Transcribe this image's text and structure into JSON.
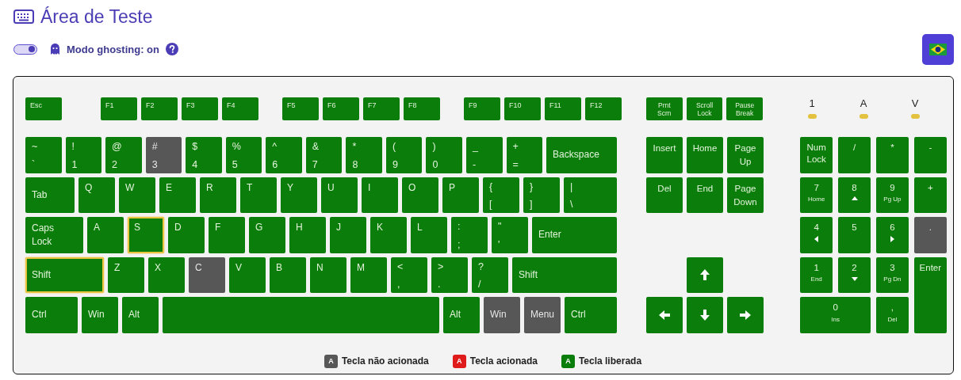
{
  "header": {
    "title": "Área de Teste"
  },
  "ghosting": {
    "on": true,
    "label": "Modo ghosting: on"
  },
  "keyboard": {
    "function_row": [
      [
        {
          "kind": "fn",
          "label": "Esc",
          "released": true,
          "focused": false
        }
      ],
      [
        {
          "kind": "fn",
          "label": "F1",
          "released": true,
          "focused": false
        },
        {
          "kind": "fn",
          "label": "F2",
          "released": true,
          "focused": false
        },
        {
          "kind": "fn",
          "label": "F3",
          "released": true,
          "focused": false
        },
        {
          "kind": "fn",
          "label": "F4",
          "released": true,
          "focused": false
        }
      ],
      [
        {
          "kind": "fn",
          "label": "F5",
          "released": true,
          "focused": false
        },
        {
          "kind": "fn",
          "label": "F6",
          "released": true,
          "focused": false
        },
        {
          "kind": "fn",
          "label": "F7",
          "released": true,
          "focused": false
        },
        {
          "kind": "fn",
          "label": "F8",
          "released": true,
          "focused": false
        }
      ],
      [
        {
          "kind": "fn",
          "label": "F9",
          "released": true,
          "focused": false
        },
        {
          "kind": "fn",
          "label": "F10",
          "released": true,
          "focused": false
        },
        {
          "kind": "fn",
          "label": "F11",
          "released": true,
          "focused": false
        },
        {
          "kind": "fn",
          "label": "F12",
          "released": true,
          "focused": false
        }
      ]
    ],
    "main_rows": [
      [
        {
          "kind": "dual",
          "shift": "~",
          "base": "`",
          "released": true,
          "focused": false
        },
        {
          "kind": "dual",
          "shift": "!",
          "base": "1",
          "released": true,
          "focused": false
        },
        {
          "kind": "dual",
          "shift": "@",
          "base": "2",
          "released": true,
          "focused": false
        },
        {
          "kind": "dual",
          "shift": "#",
          "base": "3",
          "released": false,
          "focused": false
        },
        {
          "kind": "dual",
          "shift": "$",
          "base": "4",
          "released": true,
          "focused": false
        },
        {
          "kind": "dual",
          "shift": "%",
          "base": "5",
          "released": true,
          "focused": false
        },
        {
          "kind": "dual",
          "shift": "^",
          "base": "6",
          "released": true,
          "focused": false
        },
        {
          "kind": "dual",
          "shift": "&",
          "base": "7",
          "released": true,
          "focused": false
        },
        {
          "kind": "dual",
          "shift": "*",
          "base": "8",
          "released": true,
          "focused": false
        },
        {
          "kind": "dual",
          "shift": "(",
          "base": "9",
          "released": true,
          "focused": false
        },
        {
          "kind": "dual",
          "shift": ")",
          "base": "0",
          "released": true,
          "focused": false
        },
        {
          "kind": "dual",
          "shift": "_",
          "base": "-",
          "released": true,
          "focused": false
        },
        {
          "kind": "dual",
          "shift": "+",
          "base": "=",
          "released": true,
          "focused": false
        },
        {
          "kind": "mod",
          "label": "Backspace",
          "released": true,
          "focused": false
        }
      ],
      [
        {
          "kind": "mod",
          "label": "Tab",
          "released": true,
          "focused": false
        },
        {
          "kind": "char",
          "label": "Q",
          "released": true,
          "focused": false
        },
        {
          "kind": "char",
          "label": "W",
          "released": true,
          "focused": false
        },
        {
          "kind": "char",
          "label": "E",
          "released": true,
          "focused": false
        },
        {
          "kind": "char",
          "label": "R",
          "released": true,
          "focused": false
        },
        {
          "kind": "char",
          "label": "T",
          "released": true,
          "focused": false
        },
        {
          "kind": "char",
          "label": "Y",
          "released": true,
          "focused": false
        },
        {
          "kind": "char",
          "label": "U",
          "released": true,
          "focused": false
        },
        {
          "kind": "char",
          "label": "I",
          "released": true,
          "focused": false
        },
        {
          "kind": "char",
          "label": "O",
          "released": true,
          "focused": false
        },
        {
          "kind": "char",
          "label": "P",
          "released": true,
          "focused": false
        },
        {
          "kind": "dual",
          "shift": "{",
          "base": "[",
          "released": true,
          "focused": false
        },
        {
          "kind": "dual",
          "shift": "}",
          "base": "]",
          "released": true,
          "focused": false
        },
        {
          "kind": "dual",
          "shift": "|",
          "base": "\\",
          "released": true,
          "focused": false
        }
      ],
      [
        {
          "kind": "mod",
          "label": "Caps Lock",
          "released": true,
          "focused": false
        },
        {
          "kind": "char",
          "label": "A",
          "released": true,
          "focused": false
        },
        {
          "kind": "char",
          "label": "S",
          "released": true,
          "focused": true
        },
        {
          "kind": "char",
          "label": "D",
          "released": true,
          "focused": false
        },
        {
          "kind": "char",
          "label": "F",
          "released": true,
          "focused": false
        },
        {
          "kind": "char",
          "label": "G",
          "released": true,
          "focused": false
        },
        {
          "kind": "char",
          "label": "H",
          "released": true,
          "focused": false
        },
        {
          "kind": "char",
          "label": "J",
          "released": true,
          "focused": false
        },
        {
          "kind": "char",
          "label": "K",
          "released": true,
          "focused": false
        },
        {
          "kind": "char",
          "label": "L",
          "released": true,
          "focused": false
        },
        {
          "kind": "dual",
          "shift": ":",
          "base": ";",
          "released": true,
          "focused": false
        },
        {
          "kind": "dual",
          "shift": "\"",
          "base": "'",
          "released": true,
          "focused": false
        },
        {
          "kind": "mod",
          "label": "Enter",
          "released": true,
          "focused": false
        }
      ],
      [
        {
          "kind": "mod",
          "label": "Shift",
          "released": true,
          "focused": true
        },
        {
          "kind": "char",
          "label": "Z",
          "released": true,
          "focused": false
        },
        {
          "kind": "char",
          "label": "X",
          "released": true,
          "focused": false
        },
        {
          "kind": "char",
          "label": "C",
          "released": false,
          "focused": false
        },
        {
          "kind": "char",
          "label": "V",
          "released": true,
          "focused": false
        },
        {
          "kind": "char",
          "label": "B",
          "released": true,
          "focused": false
        },
        {
          "kind": "char",
          "label": "N",
          "released": true,
          "focused": false
        },
        {
          "kind": "char",
          "label": "M",
          "released": true,
          "focused": false
        },
        {
          "kind": "dual",
          "shift": "<",
          "base": ",",
          "released": true,
          "focused": false
        },
        {
          "kind": "dual",
          "shift": ">",
          "base": ".",
          "released": true,
          "focused": false
        },
        {
          "kind": "dual",
          "shift": "?",
          "base": "/",
          "released": true,
          "focused": false
        },
        {
          "kind": "mod",
          "label": "Shift",
          "released": true,
          "focused": false
        }
      ],
      [
        {
          "kind": "mod",
          "label": "Ctrl",
          "released": true,
          "focused": false
        },
        {
          "kind": "mod",
          "label": "Win",
          "released": true,
          "focused": false
        },
        {
          "kind": "mod",
          "label": "Alt",
          "released": true,
          "focused": false
        },
        {
          "kind": "space",
          "released": true,
          "focused": false
        },
        {
          "kind": "mod",
          "label": "Alt",
          "released": true,
          "focused": false
        },
        {
          "kind": "mod",
          "label": "Win",
          "released": false,
          "focused": false
        },
        {
          "kind": "mod",
          "label": "Menu",
          "released": false,
          "focused": false
        },
        {
          "kind": "mod",
          "label": "Ctrl",
          "released": true,
          "focused": false
        }
      ]
    ],
    "system_keys": [
      {
        "kind": "sys",
        "label": "Prnt Scrn",
        "released": true,
        "focused": false
      },
      {
        "kind": "sys",
        "label": "Scroll Lock",
        "released": true,
        "focused": false
      },
      {
        "kind": "sys",
        "label": "Pause Break",
        "released": true,
        "focused": false
      }
    ],
    "nav_keys": [
      {
        "kind": "nav",
        "label": "Insert",
        "released": true,
        "focused": false
      },
      {
        "kind": "nav",
        "label": "Home",
        "released": true,
        "focused": false
      },
      {
        "kind": "nav",
        "label": "Page Up",
        "released": true,
        "focused": false
      },
      {
        "kind": "nav",
        "label": "Del",
        "released": true,
        "focused": false
      },
      {
        "kind": "nav",
        "label": "End",
        "released": true,
        "focused": false
      },
      {
        "kind": "nav",
        "label": "Page Down",
        "released": true,
        "focused": false
      }
    ],
    "arrow_keys": [
      {
        "kind": "arrow",
        "released": true,
        "focused": false
      },
      {
        "kind": "arrow",
        "released": true,
        "focused": false
      },
      {
        "kind": "arrow",
        "released": true,
        "focused": false
      },
      {
        "kind": "arrow",
        "released": true,
        "focused": false
      }
    ],
    "lock_indicators": [
      {
        "label": "1",
        "on": true
      },
      {
        "label": "A",
        "on": true
      },
      {
        "label": "V",
        "on": true
      }
    ],
    "numpad": [
      {
        "kind": "num",
        "label": "Num Lock",
        "released": true,
        "focused": false
      },
      {
        "kind": "num",
        "label": "/",
        "released": true,
        "focused": false
      },
      {
        "kind": "num",
        "label": "*",
        "released": true,
        "focused": false
      },
      {
        "kind": "num",
        "label": "-",
        "released": true,
        "focused": false
      },
      {
        "kind": "num",
        "label": "7",
        "sub": "Home",
        "released": true,
        "focused": false
      },
      {
        "kind": "num",
        "label": "8",
        "released": true,
        "focused": false
      },
      {
        "kind": "num",
        "label": "9",
        "sub": "Pg Up",
        "released": true,
        "focused": false
      },
      {
        "kind": "num",
        "label": "+",
        "released": true,
        "focused": false
      },
      {
        "kind": "num",
        "label": "4",
        "released": true,
        "focused": false
      },
      {
        "kind": "num",
        "label": "5",
        "released": true,
        "focused": false
      },
      {
        "kind": "num",
        "label": "6",
        "released": true,
        "focused": false
      },
      {
        "kind": "num",
        "label": ".",
        "released": false,
        "focused": false
      },
      {
        "kind": "num",
        "label": "1",
        "sub": "End",
        "released": true,
        "focused": false
      },
      {
        "kind": "num",
        "label": "2",
        "released": true,
        "focused": false
      },
      {
        "kind": "num",
        "label": "3",
        "sub": "Pg Dn",
        "released": true,
        "focused": false
      },
      {
        "kind": "num",
        "label": "Enter",
        "released": true,
        "focused": false
      },
      {
        "kind": "num",
        "label": "0",
        "sub": "Ins",
        "released": true,
        "focused": false
      },
      {
        "kind": "num",
        "label": ",",
        "sub": "Del",
        "released": true,
        "focused": false
      }
    ]
  },
  "legend": [
    {
      "swatch": "A",
      "label": "Tecla não acionada",
      "color": "#575757"
    },
    {
      "swatch": "A",
      "label": "Tecla acionada",
      "color": "#e01b1b"
    },
    {
      "swatch": "A",
      "label": "Tecla liberada",
      "color": "#0a7d0a"
    }
  ]
}
